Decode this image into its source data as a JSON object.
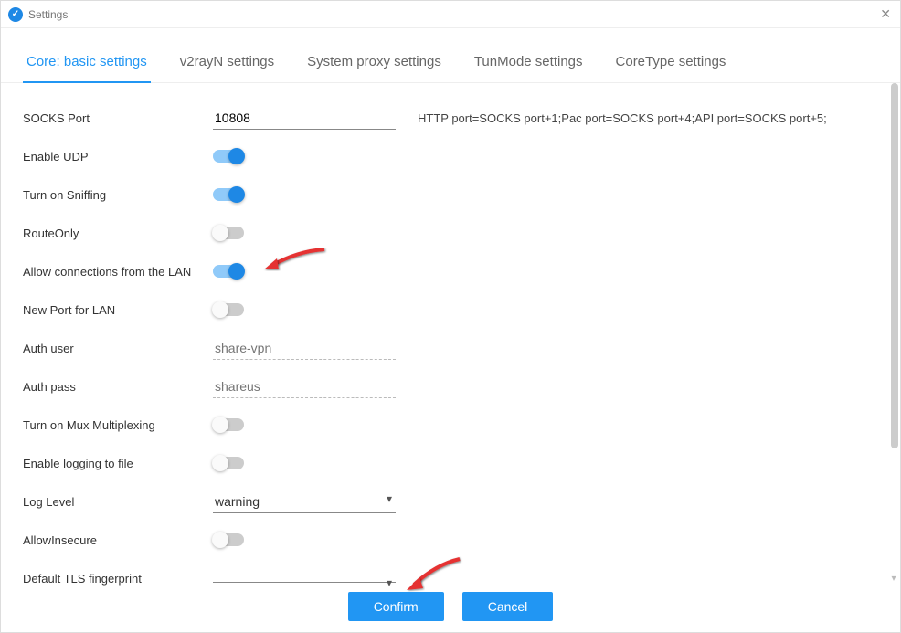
{
  "window": {
    "title": "Settings"
  },
  "tabs": [
    {
      "label": "Core: basic settings",
      "active": true
    },
    {
      "label": "v2rayN settings",
      "active": false
    },
    {
      "label": "System proxy settings",
      "active": false
    },
    {
      "label": "TunMode settings",
      "active": false
    },
    {
      "label": "CoreType settings",
      "active": false
    }
  ],
  "fields": {
    "socks_port": {
      "label": "SOCKS Port",
      "value": "10808",
      "hint": "HTTP port=SOCKS port+1;Pac port=SOCKS port+4;API port=SOCKS port+5;"
    },
    "enable_udp": {
      "label": "Enable UDP",
      "on": true
    },
    "sniffing": {
      "label": "Turn on Sniffing",
      "on": true
    },
    "route_only": {
      "label": "RouteOnly",
      "on": false
    },
    "allow_lan": {
      "label": "Allow connections from the LAN",
      "on": true
    },
    "new_port_lan": {
      "label": "New Port for LAN",
      "on": false
    },
    "auth_user": {
      "label": "Auth user",
      "placeholder": "share-vpn"
    },
    "auth_pass": {
      "label": "Auth pass",
      "placeholder": "shareus"
    },
    "mux": {
      "label": "Turn on Mux Multiplexing",
      "on": false
    },
    "logging": {
      "label": "Enable logging to file",
      "on": false
    },
    "log_level": {
      "label": "Log Level",
      "value": "warning"
    },
    "allow_insecure": {
      "label": "AllowInsecure",
      "on": false
    },
    "tls_fingerprint": {
      "label": "Default TLS fingerprint",
      "value": ""
    }
  },
  "buttons": {
    "confirm": "Confirm",
    "cancel": "Cancel"
  },
  "colors": {
    "accent": "#2196f3",
    "arrow": "#e53030"
  }
}
